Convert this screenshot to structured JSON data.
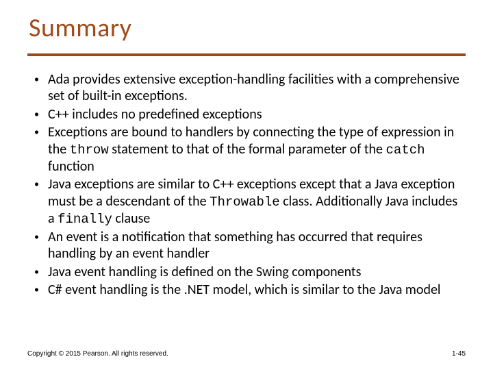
{
  "title": "Summary",
  "bullets": [
    {
      "segments": [
        {
          "t": "Ada provides extensive exception-handling facilities with a comprehensive set of built-in exceptions."
        }
      ]
    },
    {
      "segments": [
        {
          "t": "C++ includes no predefined exceptions"
        }
      ]
    },
    {
      "segments": [
        {
          "t": "Exceptions are bound to handlers by connecting the type of expression in the "
        },
        {
          "t": "throw",
          "mono": true
        },
        {
          "t": " statement to that of the formal parameter of the "
        },
        {
          "t": "catch",
          "mono": true
        },
        {
          "t": " function"
        }
      ]
    },
    {
      "segments": [
        {
          "t": "Java exceptions are similar to C++ exceptions except that a Java exception must be a descendant of the "
        },
        {
          "t": "Throwable",
          "mono": true
        },
        {
          "t": " class. Additionally Java includes a "
        },
        {
          "t": "finally",
          "mono": true
        },
        {
          "t": " clause"
        }
      ]
    },
    {
      "segments": [
        {
          "t": "An event is a notification that something has occurred that requires handling by an event handler"
        }
      ]
    },
    {
      "segments": [
        {
          "t": "Java event handling is defined on the Swing components"
        }
      ]
    },
    {
      "segments": [
        {
          "t": "C# event handling is the .NET model, which is similar to the Java model"
        }
      ]
    }
  ],
  "footer": {
    "copyright": "Copyright © 2015 Pearson. All rights reserved.",
    "page": "1-45"
  }
}
